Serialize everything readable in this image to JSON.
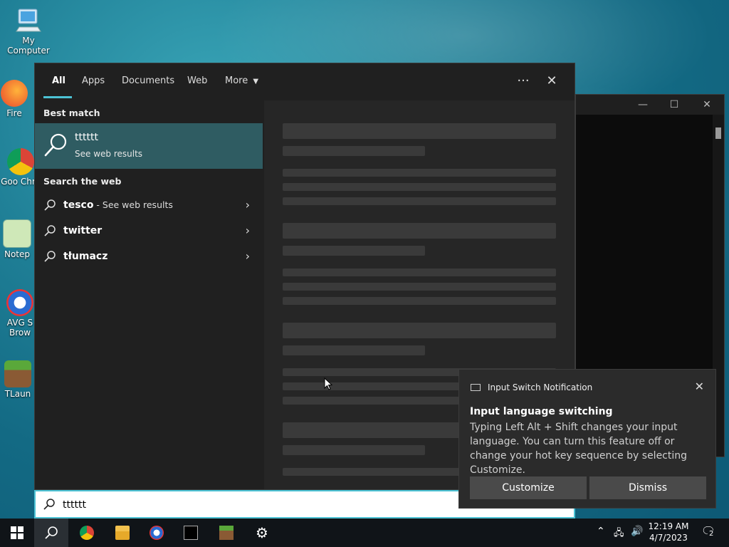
{
  "desktop": {
    "icons": [
      {
        "label": "My Computer"
      },
      {
        "label": "Fire"
      },
      {
        "label": "Goo Chro"
      },
      {
        "label": "Notep"
      },
      {
        "label": "AVG S Brow"
      },
      {
        "label": "TLaun"
      }
    ]
  },
  "search": {
    "tabs": [
      "All",
      "Apps",
      "Documents",
      "Web",
      "More"
    ],
    "more_icon": "ellipsis-icon",
    "close_icon": "close-icon",
    "best_match_heading": "Best match",
    "best_match": {
      "title": "tttttt",
      "subtitle": "See web results"
    },
    "web_heading": "Search the web",
    "web_items": [
      {
        "bold": "tesco",
        "extra": " - See web results"
      },
      {
        "bold": "twitter",
        "extra": ""
      },
      {
        "bold": "tłumacz",
        "extra": ""
      }
    ],
    "query": "tttttt"
  },
  "toast": {
    "header": "Input Switch Notification",
    "title": "Input language switching",
    "body": "Typing Left Alt + Shift changes your input language. You can turn this feature off or change your hot key sequence by selecting Customize.",
    "customize_label": "Customize",
    "dismiss_label": "Dismiss"
  },
  "taskbar": {
    "time": "12:19 AM",
    "date": "4/7/2023",
    "notification_count": "2"
  },
  "colors": {
    "accent": "#4cc2d4",
    "best_match_bg": "#2f5c62"
  }
}
